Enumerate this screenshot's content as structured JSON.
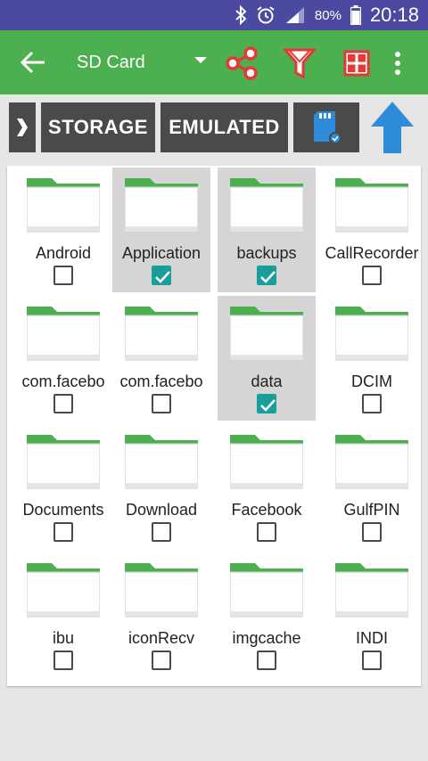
{
  "status_bar": {
    "battery_text": "80%",
    "time": "20:18",
    "icons": [
      "bluetooth-icon",
      "alarm-icon",
      "signal-icon",
      "battery-icon"
    ]
  },
  "toolbar": {
    "title": "SD Card",
    "icons": [
      "back-arrow-icon",
      "dropdown-icon",
      "share-icon",
      "filter-icon",
      "grid-view-icon",
      "more-vert-icon"
    ]
  },
  "breadcrumb": {
    "items": [
      "STORAGE",
      "EMULATED"
    ],
    "icons": [
      "sd-card-icon",
      "up-arrow-icon"
    ]
  },
  "files": [
    {
      "name": "Android",
      "checked": false
    },
    {
      "name": "Application",
      "checked": true
    },
    {
      "name": "backups",
      "checked": true
    },
    {
      "name": "CallRecorder",
      "checked": false
    },
    {
      "name": "com.facebo",
      "checked": false
    },
    {
      "name": "com.facebo",
      "checked": false
    },
    {
      "name": "data",
      "checked": true
    },
    {
      "name": "DCIM",
      "checked": false
    },
    {
      "name": "Documents",
      "checked": false
    },
    {
      "name": "Download",
      "checked": false
    },
    {
      "name": "Facebook",
      "checked": false
    },
    {
      "name": "GulfPIN",
      "checked": false
    },
    {
      "name": "ibu",
      "checked": false
    },
    {
      "name": "iconRecv",
      "checked": false
    },
    {
      "name": "imgcache",
      "checked": false
    },
    {
      "name": "INDI",
      "checked": false
    }
  ],
  "colors": {
    "status_bar": "#4b4aa0",
    "toolbar": "#4caf50",
    "folder_top": "#4caf50",
    "checkbox_checked": "#1a9e9a",
    "share_icon": "#e53935",
    "filter_icon": "#e53935",
    "grid_icon": "#e53935",
    "up_arrow": "#2e8bd8"
  }
}
